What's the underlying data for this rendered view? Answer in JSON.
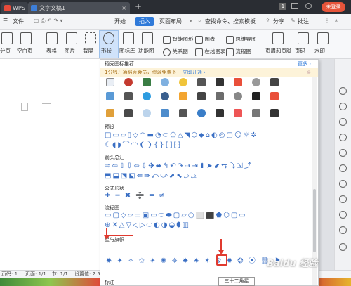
{
  "titlebar": {
    "app_tab": "WPS",
    "doc_tab": "文字文稿1",
    "close": "×",
    "new_tab": "+",
    "window_badge": "1",
    "login": "未登录"
  },
  "menubar": {
    "file": "文件",
    "items": [
      "开始",
      "插入",
      "页面布局"
    ],
    "search": "查找命令、搜索模板",
    "share": "分享",
    "comment": "批注"
  },
  "toolbar": {
    "buttons": [
      "分页",
      "空白页",
      "表格",
      "图片",
      "截屏",
      "形状",
      "图标库",
      "功能图",
      "智能图形",
      "图表",
      "关系图",
      "在线图表",
      "思维导图",
      "流程图",
      "页眉和页脚",
      "页码",
      "水印"
    ]
  },
  "panel": {
    "header": "稻壳图标推荐",
    "more": "更多",
    "vip_text": "1分钱开通稻壳会员，资源免费下",
    "vip_link": "立即开通",
    "sections": [
      "预设",
      "箭头总汇",
      "公式形状",
      "流程图",
      "星与旗帜",
      "标注"
    ],
    "tooltip": "三十二角星"
  },
  "statusbar": {
    "page_count": "页码: 1",
    "pages": "页面: 1/1",
    "section": "节: 1/1",
    "setting": "设置值: 2.5厘米"
  },
  "watermark": "Baidu 经验"
}
